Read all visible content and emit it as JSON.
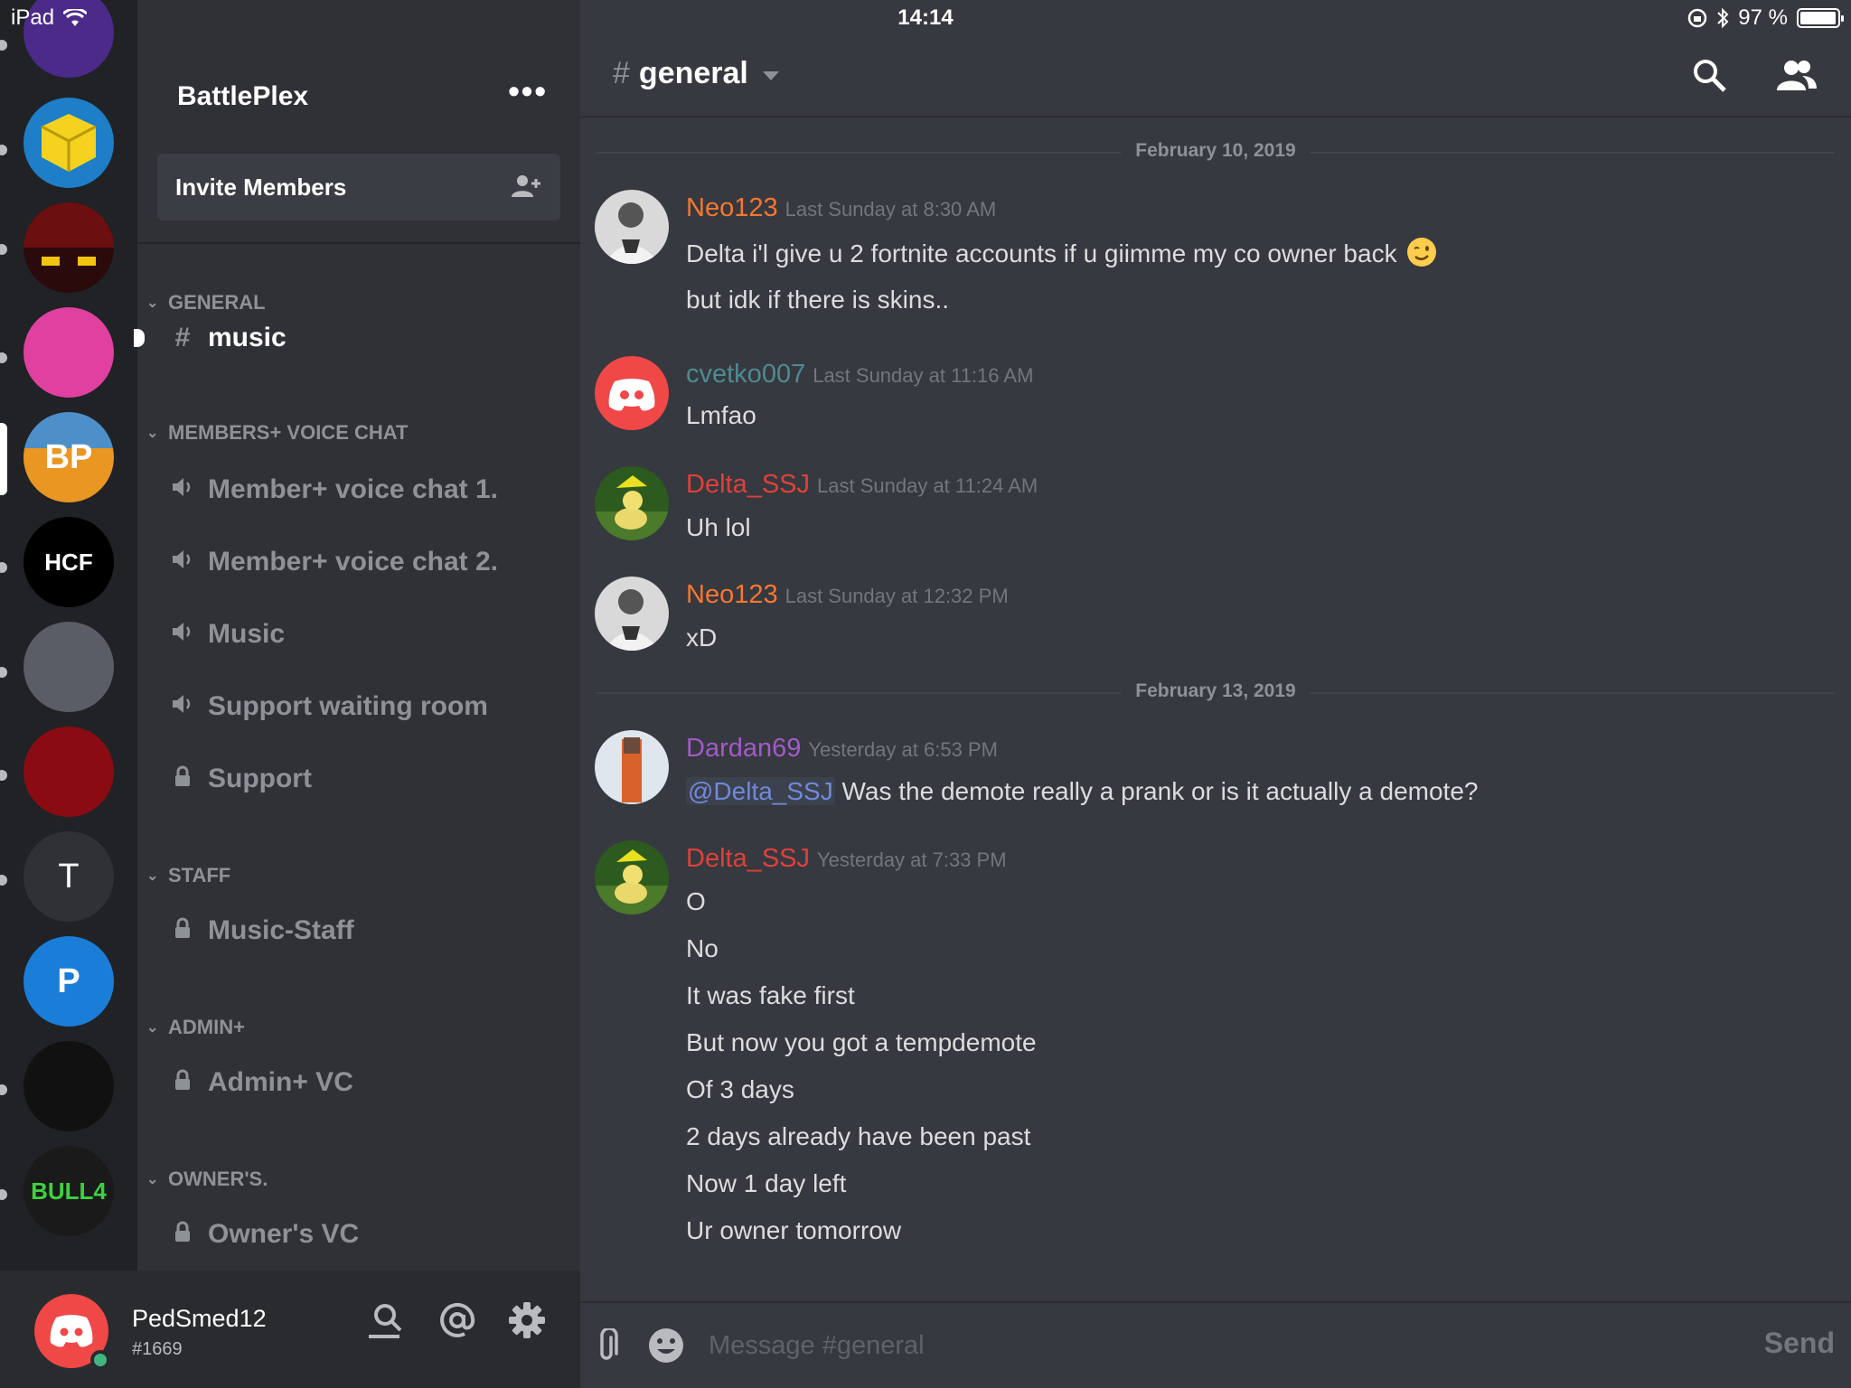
{
  "status_bar": {
    "device": "iPad",
    "time": "14:14",
    "battery": "97 %",
    "battery_level_pct": 97
  },
  "server_rail": {
    "servers": [
      {
        "name": "purple",
        "color": "#4b2a8a"
      },
      {
        "name": "yellow-cube",
        "color": "#1e7fc8"
      },
      {
        "name": "red-black",
        "color": "#2a0a0a"
      },
      {
        "name": "pink",
        "color": "#e040a0"
      },
      {
        "name": "battleplex",
        "color": "#3b6ea5",
        "letter": "BP"
      },
      {
        "name": "hcf",
        "color": "#000000",
        "letter": "HCF"
      },
      {
        "name": "anime",
        "color": "#5a5d66"
      },
      {
        "name": "red-hood",
        "color": "#8a0c12"
      },
      {
        "name": "t-server",
        "color": "#2f3136",
        "letter": "T"
      },
      {
        "name": "paypal",
        "color": "#1a7ed8",
        "letter": "P"
      },
      {
        "name": "clown",
        "color": "#111111"
      },
      {
        "name": "bull4",
        "color": "#1a1a1a",
        "letter": "BULL4"
      }
    ]
  },
  "sidebar": {
    "guild_name": "BattlePlex",
    "invite_label": "Invite Members",
    "categories": [
      {
        "name": "GENERAL",
        "channels": [
          {
            "name": "music",
            "type": "text",
            "active": true
          }
        ]
      },
      {
        "name": "MEMBERS+ VOICE CHAT",
        "channels": [
          {
            "name": "Member+ voice chat 1.",
            "type": "voice"
          },
          {
            "name": "Member+ voice chat 2.",
            "type": "voice"
          },
          {
            "name": "Music",
            "type": "voice"
          },
          {
            "name": "Support waiting room",
            "type": "voice"
          },
          {
            "name": "Support",
            "type": "locked"
          }
        ]
      },
      {
        "name": "STAFF",
        "channels": [
          {
            "name": "Music-Staff",
            "type": "locked"
          }
        ]
      },
      {
        "name": "ADMIN+",
        "channels": [
          {
            "name": "Admin+ VC",
            "type": "locked"
          }
        ]
      },
      {
        "name": "OWNER'S.",
        "channels": [
          {
            "name": "Owner's VC",
            "type": "locked"
          }
        ]
      }
    ]
  },
  "user_panel": {
    "username": "PedSmed12",
    "discriminator": "#1669",
    "status_color": "#43b581"
  },
  "chat": {
    "channel_name": "general",
    "dividers": [
      "February 10, 2019",
      "February 13, 2019"
    ],
    "messages": [
      {
        "author": "Neo123",
        "color": "#f57731",
        "time": "Last Sunday at 8:30 AM",
        "avatar": "photo-bw",
        "lines": [
          "Delta i'l give u 2 fortnite accounts if u giimme my co owner back",
          "but idk if there is skins.."
        ]
      },
      {
        "author": "cvetko007",
        "color": "#4e8b92",
        "time": "Last Sunday at 11:16 AM",
        "avatar": "discord-red",
        "lines": [
          "Lmfao"
        ]
      },
      {
        "author": "Delta_SSJ",
        "color": "#e0403a",
        "time": "Last Sunday at 11:24 AM",
        "avatar": "duck",
        "lines": [
          "Uh lol"
        ]
      },
      {
        "author": "Neo123",
        "color": "#f57731",
        "time": "Last Sunday at 12:32 PM",
        "avatar": "photo-bw",
        "lines": [
          "xD"
        ]
      },
      {
        "author": "Dardan69",
        "color": "#a35ac9",
        "time": "Yesterday at 6:53 PM",
        "avatar": "fighter",
        "mention": "@Delta_SSJ",
        "lines": [
          "Was the demote really a prank or is it actually a demote?"
        ]
      },
      {
        "author": "Delta_SSJ",
        "color": "#e0403a",
        "time": "Yesterday at 7:33 PM",
        "avatar": "duck",
        "lines": [
          "O",
          "No",
          "It was fake first",
          "But now you got a tempdemote",
          "Of 3 days",
          "2 days already have been past",
          "Now 1 day left",
          "Ur owner tomorrow"
        ]
      }
    ]
  },
  "composer": {
    "placeholder": "Message #general",
    "send_label": "Send"
  }
}
